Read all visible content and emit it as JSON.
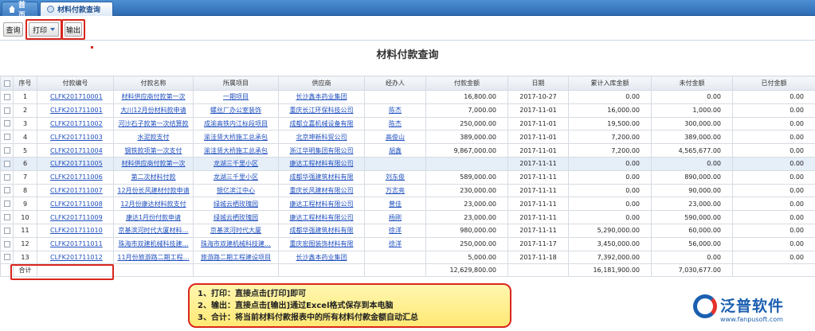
{
  "tabs": [
    {
      "label": "首页",
      "icon": "home-icon"
    },
    {
      "label": "材料付款查询",
      "icon": "document-icon"
    }
  ],
  "toolbar": {
    "query_label": "查询",
    "print_label": "打印",
    "export_label": "输出"
  },
  "report": {
    "title": "材料付款查询"
  },
  "columns": [
    "序号",
    "付款编号",
    "付款名称",
    "所属项目",
    "供应商",
    "经办人",
    "付款金额",
    "日期",
    "累计入库金额",
    "未付金额",
    "已付金额"
  ],
  "rows": [
    {
      "no": "1",
      "code": "CLFK201710001",
      "name": "材料供应商付款第一次",
      "project": "一期项目",
      "supplier": "长沙鑫本药业集团",
      "handler": "",
      "amount": "16,800.00",
      "date": "2017-10-27",
      "stocked": "0.00",
      "unpaid": "0.00",
      "paid": "0.00"
    },
    {
      "no": "2",
      "code": "CLFK201711001",
      "name": "大川12月份材料款申请",
      "project": "螺丝厂办公室装饰",
      "supplier": "重庆长江环保科技公司",
      "handler": "陈杰",
      "amount": "7,000.00",
      "date": "2017-11-01",
      "stocked": "16,000.00",
      "unpaid": "1,000.00",
      "paid": "0.00"
    },
    {
      "no": "3",
      "code": "CLFK201711002",
      "name": "河沙石子款第一次结算款",
      "project": "成渝高铁内江标段项目",
      "supplier": "成都立嘉机械设备有限",
      "handler": "陈杰",
      "amount": "250,000.00",
      "date": "2017-11-01",
      "stocked": "19,500.00",
      "unpaid": "300,000.00",
      "paid": "0.00"
    },
    {
      "no": "4",
      "code": "CLFK201711003",
      "name": "水泥款支付",
      "project": "渝洼贤大桥施工总承包",
      "supplier": "北京坤新科贸公司",
      "handler": "高俊山",
      "amount": "389,000.00",
      "date": "2017-11-01",
      "stocked": "7,200.00",
      "unpaid": "389,000.00",
      "paid": "0.00"
    },
    {
      "no": "5",
      "code": "CLFK201711004",
      "name": "钢铁款项第一次支付",
      "project": "渝洼贤大桥施工总承包",
      "supplier": "浙江华明集团有限公司",
      "handler": "胡鑫",
      "amount": "9,867,000.00",
      "date": "2017-11-01",
      "stocked": "7,200.00",
      "unpaid": "4,565,677.00",
      "paid": "0.00"
    },
    {
      "no": "6",
      "code": "CLFK201711005",
      "name": "材料供应商付款第一次",
      "project": "龙湖三千里小区",
      "supplier": "康达工程材料有限公司",
      "handler": "",
      "amount": "",
      "date": "2017-11-11",
      "stocked": "0.00",
      "unpaid": "0.00",
      "paid": "0.00"
    },
    {
      "no": "7",
      "code": "CLFK201711006",
      "name": "第二次材料付款",
      "project": "龙湖三千里小区",
      "supplier": "成都华强建筑材料有限",
      "handler": "刘东俊",
      "amount": "589,000.00",
      "date": "2017-11-11",
      "stocked": "0.00",
      "unpaid": "890,000.00",
      "paid": "0.00"
    },
    {
      "no": "8",
      "code": "CLFK201711007",
      "name": "12月份长风建材付款申请",
      "project": "银亿滨江中心",
      "supplier": "重庆长风建材有限公司",
      "handler": "万志亮",
      "amount": "230,000.00",
      "date": "2017-11-11",
      "stocked": "0.00",
      "unpaid": "90,000.00",
      "paid": "0.00"
    },
    {
      "no": "9",
      "code": "CLFK201711008",
      "name": "12月份康达材料款支付",
      "project": "绿城云栖玫瑰园",
      "supplier": "康达工程材料有限公司",
      "handler": "曾佳",
      "amount": "23,000.00",
      "date": "2017-11-11",
      "stocked": "0.00",
      "unpaid": "23,000.00",
      "paid": "0.00"
    },
    {
      "no": "10",
      "code": "CLFK201711009",
      "name": "康达1月份付款申请",
      "project": "绿城云栖玫瑰园",
      "supplier": "康达工程材料有限公司",
      "handler": "杨刚",
      "amount": "23,000.00",
      "date": "2017-11-11",
      "stocked": "0.00",
      "unpaid": "590,000.00",
      "paid": "0.00"
    },
    {
      "no": "11",
      "code": "CLFK201711010",
      "name": "京基滨河时代大厦材料…",
      "project": "京基滨河时代大厦",
      "supplier": "成都华强建筑材料有限",
      "handler": "徐洋",
      "amount": "980,000.00",
      "date": "2017-11-11",
      "stocked": "5,290,000.00",
      "unpaid": "60,000.00",
      "paid": "0.00"
    },
    {
      "no": "12",
      "code": "CLFK201711011",
      "name": "珠海市双建机械科技建…",
      "project": "珠海市双建机械科技建…",
      "supplier": "重庆宏图装饰材料有限",
      "handler": "徐洋",
      "amount": "250,000.00",
      "date": "2017-11-17",
      "stocked": "3,450,000.00",
      "unpaid": "56,000.00",
      "paid": "0.00"
    },
    {
      "no": "13",
      "code": "CLFK201711012",
      "name": "11月份旅游路二期工程…",
      "project": "旅游路二期工程建设项目",
      "supplier": "长沙鑫本药业集团",
      "handler": "",
      "amount": "5,000.00",
      "date": "2017-11-18",
      "stocked": "7,392,000.00",
      "unpaid": "0.00",
      "paid": "0.00"
    }
  ],
  "totals": {
    "label": "合计",
    "amount": "12,629,800.00",
    "stocked": "16,181,900.00",
    "unpaid": "7,030,677.00"
  },
  "callout": {
    "line1": "1、打印：直接点击[打印]即可",
    "line2": "2、输出：直接点击[输出]通过Excel格式保存到本电脑",
    "line3": "3、合计：将当前材料付款报表中的所有材料付款金额自动汇总"
  },
  "logo": {
    "name": "泛普软件",
    "url": "www.fanpusoft.com"
  },
  "colors": {
    "brand_blue": "#1b5fb0",
    "highlight_red": "#d9261c",
    "link_blue": "#1f4fbf",
    "callout_yellow": "#ffe874"
  }
}
